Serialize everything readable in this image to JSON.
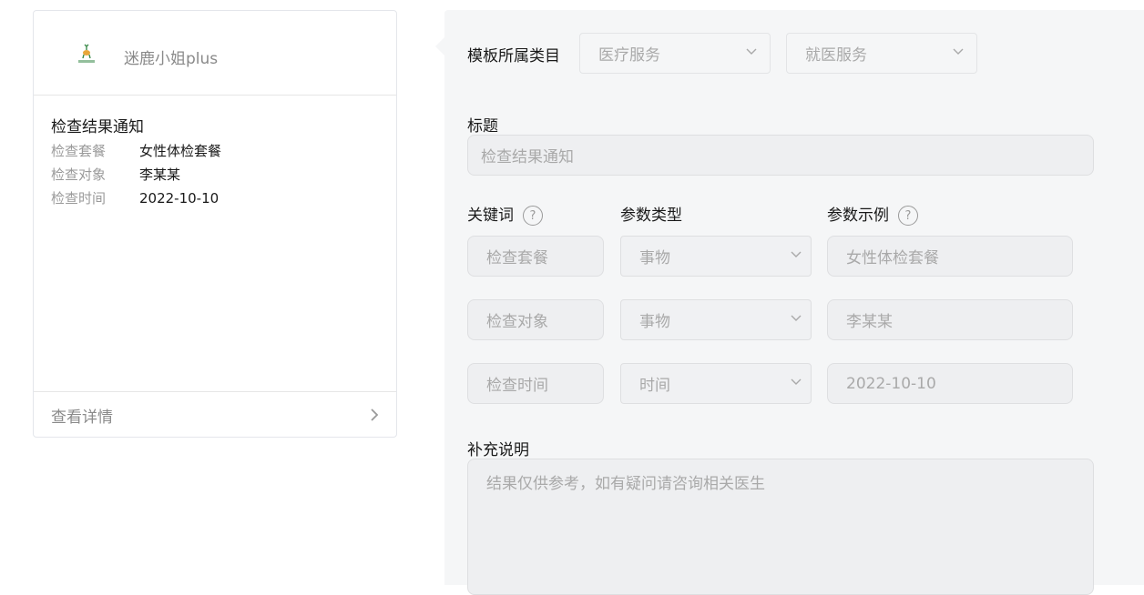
{
  "preview": {
    "account_name": "迷鹿小姐plus",
    "logo_text": "迷鹿小姐",
    "notice_title": "检查结果通知",
    "rows": [
      {
        "key": "检查套餐",
        "value": "女性体检套餐"
      },
      {
        "key": "检查对象",
        "value": "李某某"
      },
      {
        "key": "检查时间",
        "value": "2022-10-10"
      }
    ],
    "details_label": "查看详情"
  },
  "form": {
    "category_label": "模板所属类目",
    "category_primary": "医疗服务",
    "category_secondary": "就医服务",
    "title_label": "标题",
    "title_value": "检查结果通知",
    "keyword_label": "关键词",
    "param_type_label": "参数类型",
    "param_example_label": "参数示例",
    "params": [
      {
        "keyword": "检查套餐",
        "type": "事物",
        "example": "女性体检套餐"
      },
      {
        "keyword": "检查对象",
        "type": "事物",
        "example": "李某某"
      },
      {
        "keyword": "检查时间",
        "type": "时间",
        "example": "2022-10-10"
      }
    ],
    "note_label": "补充说明",
    "note_value": "结果仅供参考，如有疑问请咨询相关医生"
  },
  "colors": {
    "panel_bg": "#f5f6f7",
    "field_bg": "#eeeff1",
    "text_primary": "#191919",
    "text_muted": "#a9a9a9"
  }
}
